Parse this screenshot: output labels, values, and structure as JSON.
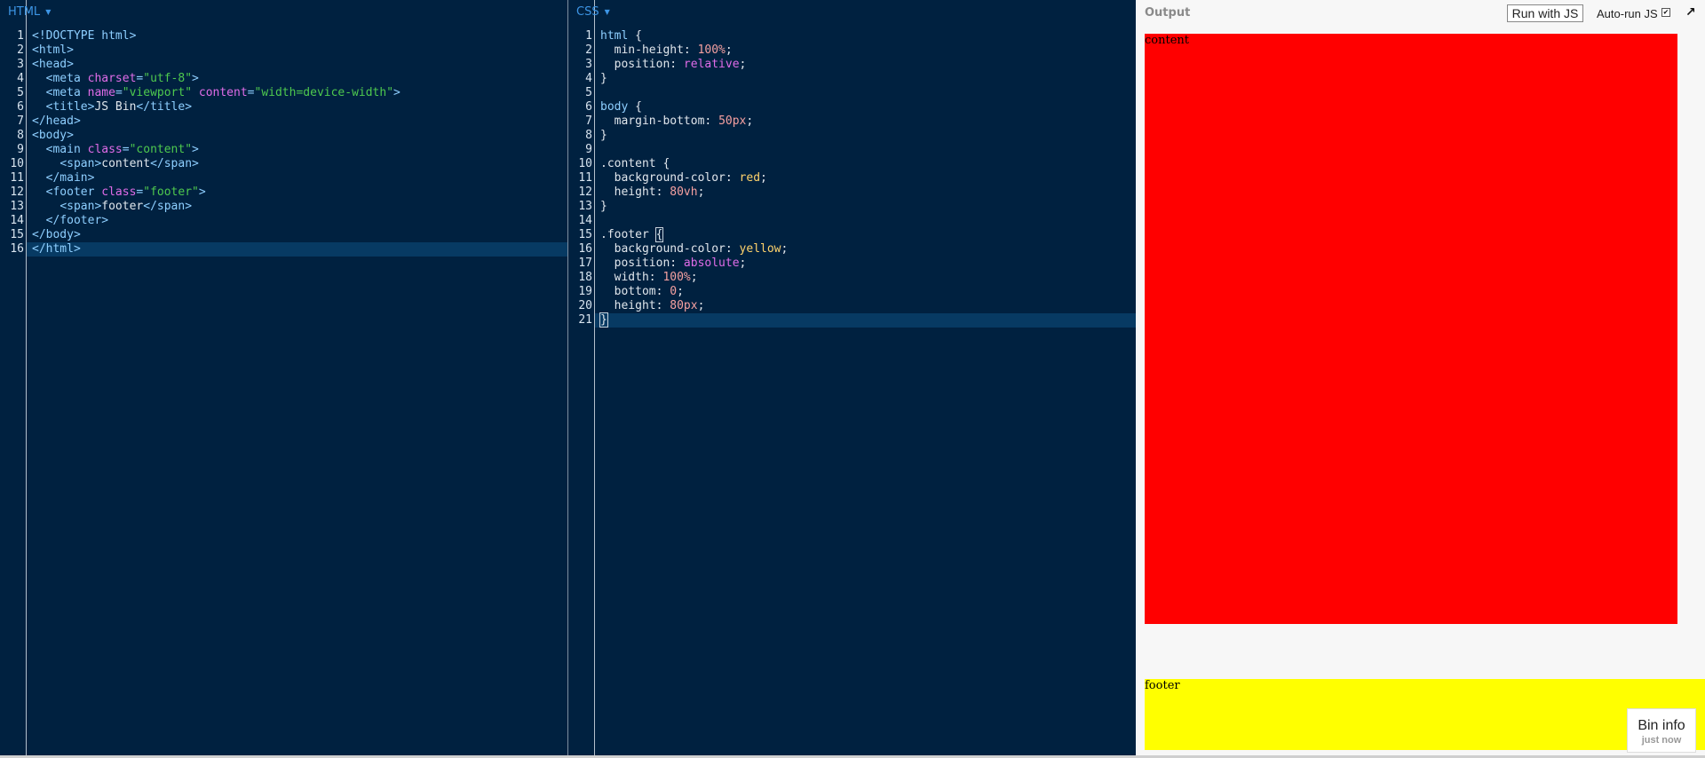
{
  "html_panel": {
    "label": "HTML",
    "line_numbers": [
      "1",
      "2",
      "3",
      "4",
      "5",
      "6",
      "7",
      "8",
      "9",
      "10",
      "11",
      "12",
      "13",
      "14",
      "15",
      "16"
    ],
    "active_line": 16
  },
  "css_panel": {
    "label": "CSS",
    "line_numbers": [
      "1",
      "2",
      "3",
      "4",
      "5",
      "6",
      "7",
      "8",
      "9",
      "10",
      "11",
      "12",
      "13",
      "14",
      "15",
      "16",
      "17",
      "18",
      "19",
      "20",
      "21"
    ],
    "active_line": 21
  },
  "html_code": [
    [
      [
        "tag",
        "<!DOCTYPE html>"
      ]
    ],
    [
      [
        "tag",
        "<html>"
      ]
    ],
    [
      [
        "tag",
        "<head>"
      ]
    ],
    [
      [
        "text",
        "  "
      ],
      [
        "tag",
        "<meta "
      ],
      [
        "attr",
        "charset"
      ],
      [
        "tag",
        "="
      ],
      [
        "str",
        "\"utf-8\""
      ],
      [
        "tag",
        ">"
      ]
    ],
    [
      [
        "text",
        "  "
      ],
      [
        "tag",
        "<meta "
      ],
      [
        "attr",
        "name"
      ],
      [
        "tag",
        "="
      ],
      [
        "str",
        "\"viewport\""
      ],
      [
        "text",
        " "
      ],
      [
        "attr",
        "content"
      ],
      [
        "tag",
        "="
      ],
      [
        "str",
        "\"width=device-width\""
      ],
      [
        "tag",
        ">"
      ]
    ],
    [
      [
        "text",
        "  "
      ],
      [
        "tag",
        "<title>"
      ],
      [
        "text",
        "JS Bin"
      ],
      [
        "tag",
        "</title>"
      ]
    ],
    [
      [
        "tag",
        "</head>"
      ]
    ],
    [
      [
        "tag",
        "<body>"
      ]
    ],
    [
      [
        "text",
        "  "
      ],
      [
        "tag",
        "<main "
      ],
      [
        "attr",
        "class"
      ],
      [
        "tag",
        "="
      ],
      [
        "str",
        "\"content\""
      ],
      [
        "tag",
        ">"
      ]
    ],
    [
      [
        "text",
        "    "
      ],
      [
        "tag",
        "<span>"
      ],
      [
        "text",
        "content"
      ],
      [
        "tag",
        "</span>"
      ]
    ],
    [
      [
        "text",
        "  "
      ],
      [
        "tag",
        "</main>"
      ]
    ],
    [
      [
        "text",
        "  "
      ],
      [
        "tag",
        "<footer "
      ],
      [
        "attr",
        "class"
      ],
      [
        "tag",
        "="
      ],
      [
        "str",
        "\"footer\""
      ],
      [
        "tag",
        ">"
      ]
    ],
    [
      [
        "text",
        "    "
      ],
      [
        "tag",
        "<span>"
      ],
      [
        "text",
        "footer"
      ],
      [
        "tag",
        "</span>"
      ]
    ],
    [
      [
        "text",
        "  "
      ],
      [
        "tag",
        "</footer>"
      ]
    ],
    [
      [
        "tag",
        "</body>"
      ]
    ],
    [
      [
        "tag",
        "</html>"
      ]
    ]
  ],
  "css_code": [
    [
      [
        "sel",
        "html"
      ],
      [
        "text",
        " {"
      ]
    ],
    [
      [
        "prop",
        "  min-height: "
      ],
      [
        "num",
        "100%"
      ],
      [
        "text",
        ";"
      ]
    ],
    [
      [
        "prop",
        "  position: "
      ],
      [
        "kw",
        "relative"
      ],
      [
        "text",
        ";"
      ]
    ],
    [
      [
        "text",
        "}"
      ]
    ],
    [
      [
        "text",
        ""
      ]
    ],
    [
      [
        "sel",
        "body"
      ],
      [
        "text",
        " {"
      ]
    ],
    [
      [
        "prop",
        "  margin-bottom: "
      ],
      [
        "num",
        "50px"
      ],
      [
        "text",
        ";"
      ]
    ],
    [
      [
        "text",
        "}"
      ]
    ],
    [
      [
        "text",
        ""
      ]
    ],
    [
      [
        "text",
        ".content {"
      ]
    ],
    [
      [
        "prop",
        "  background-color: "
      ],
      [
        "val",
        "red"
      ],
      [
        "text",
        ";"
      ]
    ],
    [
      [
        "prop",
        "  height: "
      ],
      [
        "num",
        "80vh"
      ],
      [
        "text",
        ";"
      ]
    ],
    [
      [
        "text",
        "}"
      ]
    ],
    [
      [
        "text",
        ""
      ]
    ],
    [
      [
        "text",
        ".footer "
      ],
      [
        "cursor",
        "{"
      ]
    ],
    [
      [
        "prop",
        "  background-color: "
      ],
      [
        "val",
        "yellow"
      ],
      [
        "text",
        ";"
      ]
    ],
    [
      [
        "prop",
        "  position: "
      ],
      [
        "kw",
        "absolute"
      ],
      [
        "text",
        ";"
      ]
    ],
    [
      [
        "prop",
        "  width: "
      ],
      [
        "num",
        "100%"
      ],
      [
        "text",
        ";"
      ]
    ],
    [
      [
        "prop",
        "  bottom: "
      ],
      [
        "num",
        "0"
      ],
      [
        "text",
        ";"
      ]
    ],
    [
      [
        "prop",
        "  height: "
      ],
      [
        "num",
        "80px"
      ],
      [
        "text",
        ";"
      ]
    ],
    [
      [
        "cursor",
        "}"
      ]
    ]
  ],
  "output": {
    "title": "Output",
    "run_button": "Run with JS",
    "autorun_label": "Auto-run JS",
    "autorun_checked": "✔",
    "popout_icon": "↗",
    "content_text": "content",
    "footer_text": "footer",
    "bin_info_title": "Bin info",
    "bin_info_time": "just now"
  },
  "colors": {
    "editor_bg": "#002140",
    "content_bg": "#ff0000",
    "footer_bg": "#ffff00"
  }
}
